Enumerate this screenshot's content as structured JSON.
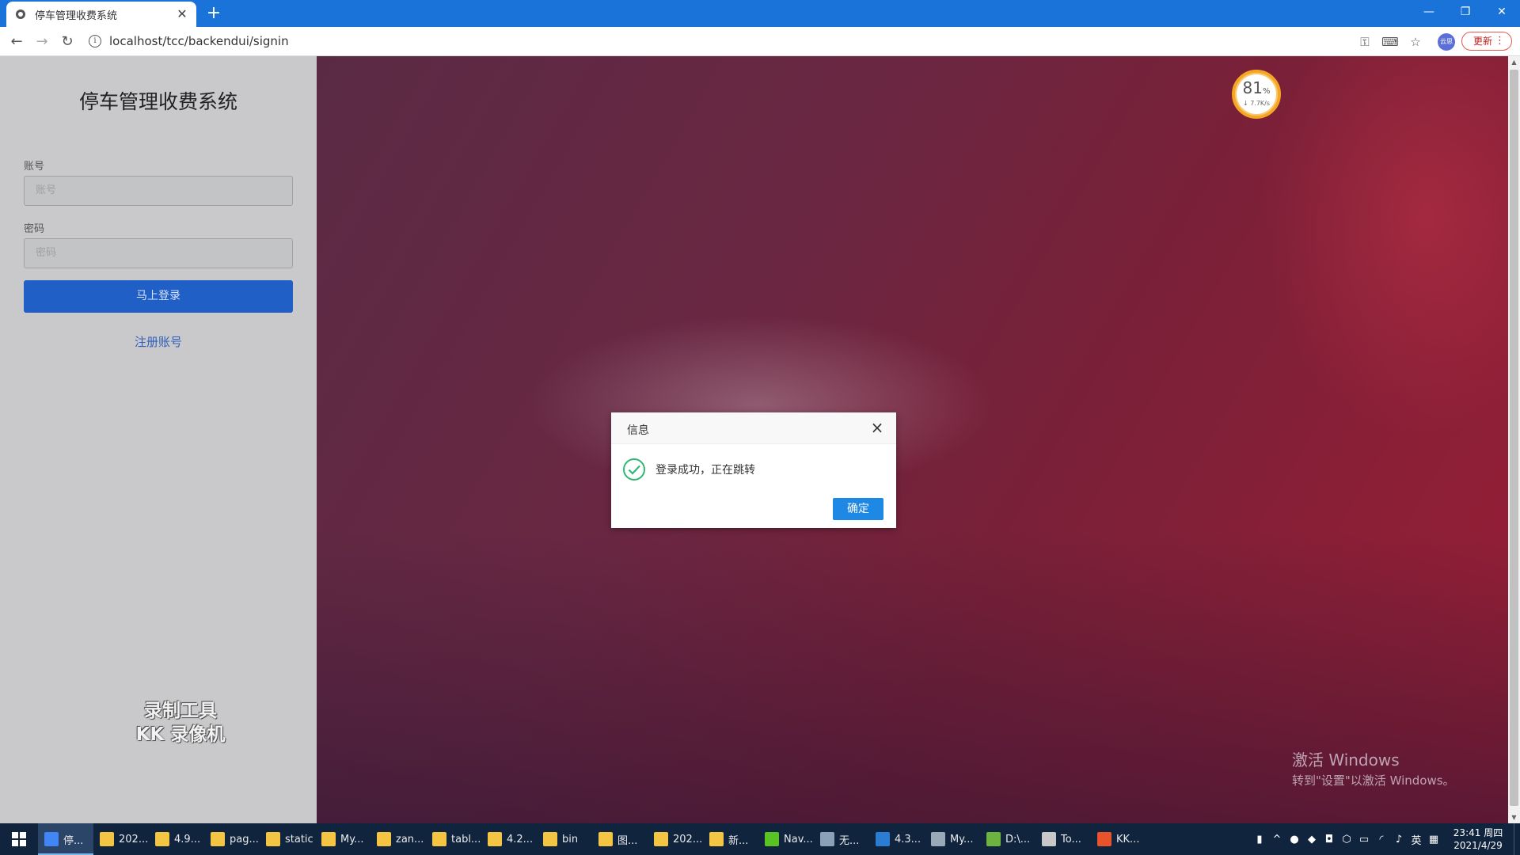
{
  "browser": {
    "tab_title": "停车管理收费系统",
    "tab_close": "✕",
    "new_tab": "+",
    "url": "localhost/tcc/backendui/signin",
    "update_label": "更新",
    "profile_label": "云思"
  },
  "login": {
    "title": "停车管理收费系统",
    "account_label": "账号",
    "account_placeholder": "账号",
    "password_label": "密码",
    "password_placeholder": "密码",
    "login_button": "马上登录",
    "register_link": "注册账号"
  },
  "watermark": {
    "line1": "录制工具",
    "line2": "KK 录像机"
  },
  "speed_widget": {
    "percent": "81",
    "percent_unit": "%",
    "rate": "↓ 7.7K/s"
  },
  "activation": {
    "line1": "激活 Windows",
    "line2": "转到\"设置\"以激活 Windows。"
  },
  "dialog": {
    "title": "信息",
    "message": "登录成功，正在跳转",
    "ok_button": "确定"
  },
  "taskbar": {
    "items": [
      {
        "label": "停...",
        "color": "#4285f4"
      },
      {
        "label": "202...",
        "color": "#f4c542"
      },
      {
        "label": "4.9...",
        "color": "#f4c542"
      },
      {
        "label": "pag...",
        "color": "#f4c542"
      },
      {
        "label": "static",
        "color": "#f4c542"
      },
      {
        "label": "My...",
        "color": "#f4c542"
      },
      {
        "label": "zan...",
        "color": "#f4c542"
      },
      {
        "label": "tabl...",
        "color": "#f4c542"
      },
      {
        "label": "4.2...",
        "color": "#f4c542"
      },
      {
        "label": "bin",
        "color": "#f4c542"
      },
      {
        "label": "图...",
        "color": "#f4c542"
      },
      {
        "label": "202...",
        "color": "#f4c542"
      },
      {
        "label": "新...",
        "color": "#f4c542"
      },
      {
        "label": "Nav...",
        "color": "#58c322"
      },
      {
        "label": "无...",
        "color": "#8aa1b8"
      },
      {
        "label": "4.3...",
        "color": "#2b7cd3"
      },
      {
        "label": "My...",
        "color": "#9aa9b8"
      },
      {
        "label": "D:\\...",
        "color": "#6db33f"
      },
      {
        "label": "To...",
        "color": "#c8c8c8"
      },
      {
        "label": "KK...",
        "color": "#e8532c"
      }
    ],
    "ime": "英",
    "time": "23:41 周四",
    "date": "2021/4/29"
  }
}
